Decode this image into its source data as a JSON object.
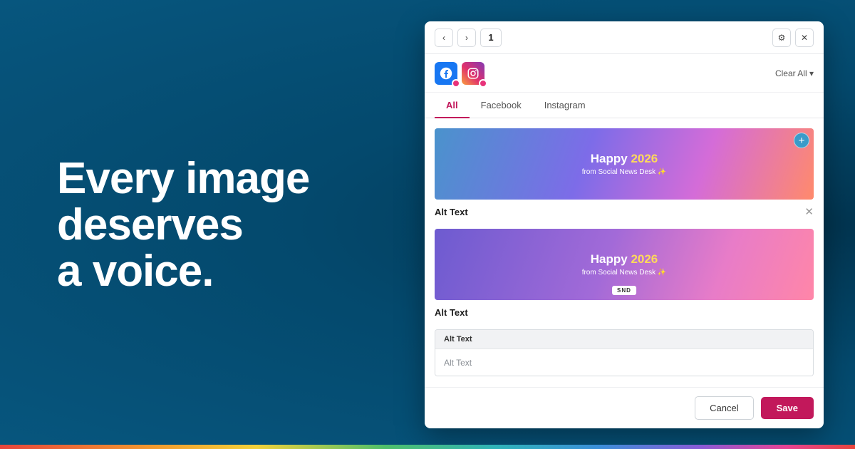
{
  "headline": {
    "line1": "Every image",
    "line2": "deserves",
    "line3": "a voice."
  },
  "toolbar": {
    "prev": "‹",
    "next": "›",
    "page": "1",
    "settings": "⚙",
    "close": "✕"
  },
  "networks": {
    "clear_all": "Clear All ▾"
  },
  "tabs": [
    {
      "label": "All",
      "active": true
    },
    {
      "label": "Facebook",
      "active": false
    },
    {
      "label": "Instagram",
      "active": false
    }
  ],
  "images": [
    {
      "happy": "Happy",
      "year": "2026",
      "sub": "from Social News Desk ✨",
      "plus": "+",
      "alt_label": "Alt Text",
      "close": "✕"
    },
    {
      "happy": "Happy",
      "year": "2026",
      "sub": "from Social News Desk ✨",
      "badge": "SND",
      "alt_label": "Alt Text"
    }
  ],
  "alt_editor": {
    "header": "Alt Text",
    "placeholder": "Alt Text",
    "value": ""
  },
  "footer": {
    "cancel": "Cancel",
    "save": "Save"
  },
  "colors": {
    "accent": "#c2185b",
    "facebook": "#1877f2",
    "background": "#04496d"
  },
  "icons": {
    "facebook": "facebook-icon",
    "instagram": "instagram-icon",
    "settings": "gear-icon",
    "close": "close-icon"
  }
}
